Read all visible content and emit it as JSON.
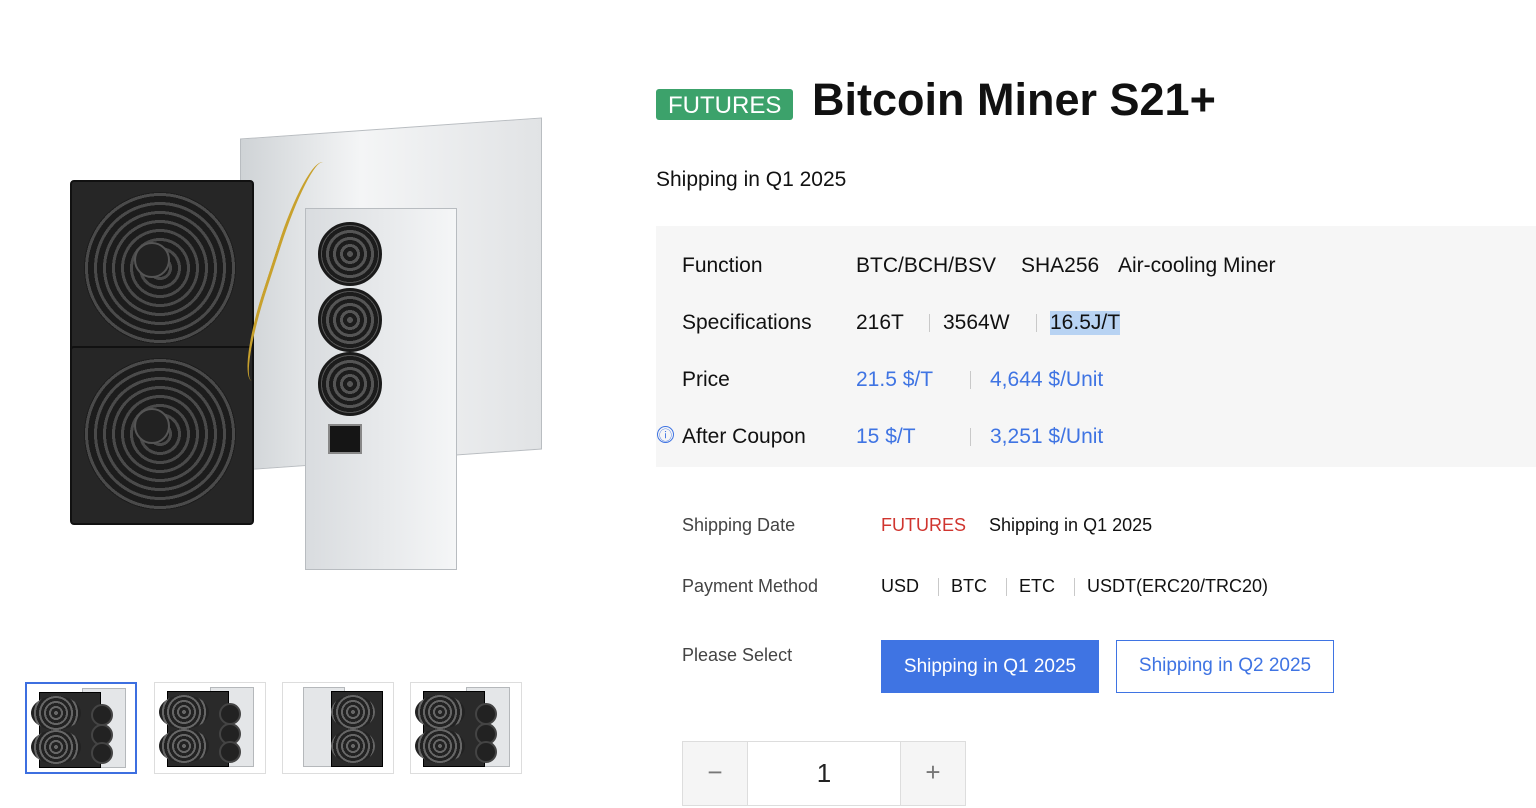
{
  "product": {
    "badge": "FUTURES",
    "title": "Bitcoin Miner S21+",
    "shipping_summary": "Shipping in Q1 2025"
  },
  "specs": {
    "function": {
      "label": "Function",
      "values": [
        "BTC/BCH/BSV",
        "SHA256",
        "Air-cooling Miner"
      ]
    },
    "specifications": {
      "label": "Specifications",
      "values": [
        "216T",
        "3564W",
        "16.5J/T"
      ]
    },
    "price": {
      "label": "Price",
      "per_t": "21.5 $/T",
      "per_unit": "4,644 $/Unit"
    },
    "after_coupon": {
      "label": "After Coupon",
      "info_icon": "ⓘ",
      "per_t": "15 $/T",
      "per_unit": "3,251 $/Unit"
    }
  },
  "shipping_date": {
    "label": "Shipping Date",
    "tag": "FUTURES",
    "value": "Shipping in Q1 2025"
  },
  "payment": {
    "label": "Payment Method",
    "methods": [
      "USD",
      "BTC",
      "ETC",
      "USDT(ERC20/TRC20)"
    ]
  },
  "select": {
    "label": "Please Select",
    "options": [
      "Shipping in Q1 2025",
      "Shipping in Q2 2025"
    ],
    "selected_index": 0
  },
  "quantity": {
    "minus": "−",
    "value": "1",
    "plus": "+"
  },
  "thumbnails": {
    "count": 4,
    "active_index": 0
  },
  "colors": {
    "accent": "#3f74e3",
    "badge_green": "#3ca26b",
    "futures_red": "#d0352f"
  }
}
